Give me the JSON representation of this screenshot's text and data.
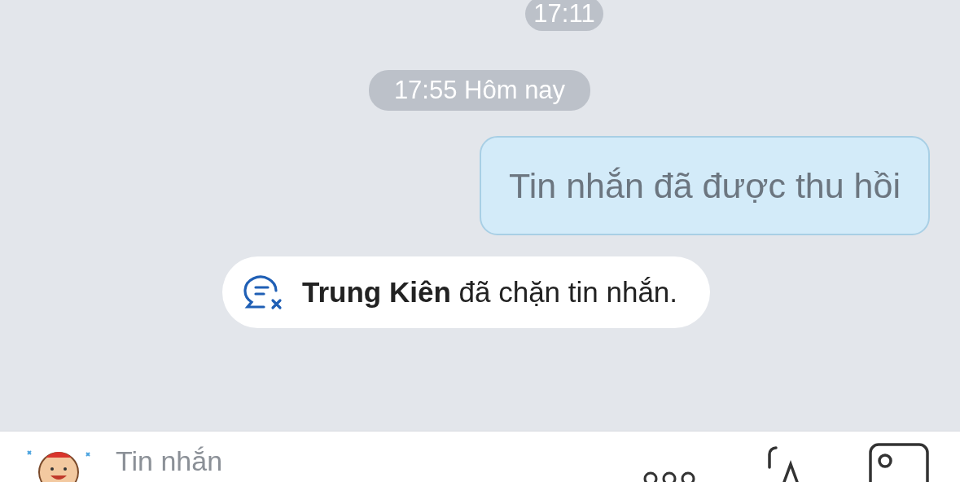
{
  "messages": [
    {
      "kind": "time",
      "text": "17:11"
    },
    {
      "kind": "time",
      "text": "17:55 Hôm nay"
    },
    {
      "kind": "recalled",
      "text": "Tin nhắn đã được thu hồi"
    },
    {
      "kind": "notice",
      "text": "**Trung Kiên** đã chặn tin nhắn."
    }
  ],
  "composer": {
    "placeholder": "Tin nhắn"
  }
}
